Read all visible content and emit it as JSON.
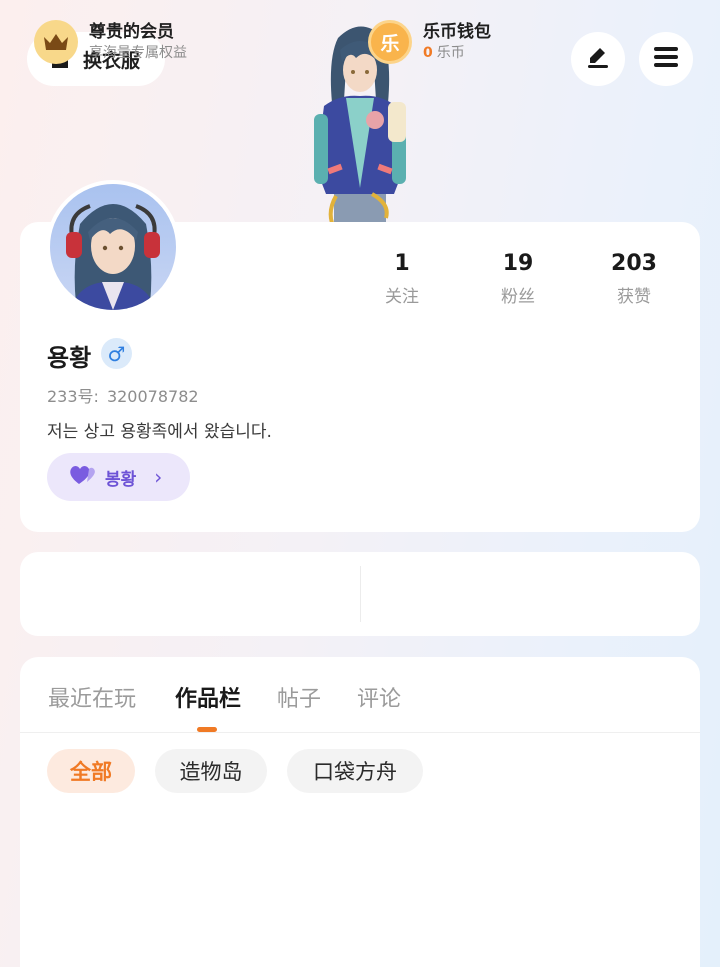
{
  "header": {
    "outfit_label": "换衣服",
    "edit_icon": "edit-pen-icon",
    "menu_icon": "hamburger-menu-icon"
  },
  "stats": [
    {
      "value": "1",
      "label": "关注"
    },
    {
      "value": "19",
      "label": "粉丝"
    },
    {
      "value": "203",
      "label": "获赞"
    }
  ],
  "profile": {
    "name": "용황",
    "gender_symbol": "♂",
    "uid_label": "233号:",
    "uid_value": "320078782",
    "bio": "저는 상고 용황족에서 왔습니다.",
    "tag_label": "봉황",
    "tag_chevron": "›"
  },
  "benefits": {
    "member_title": "尊贵的会员",
    "member_sub": "享海量专属权益",
    "wallet_title": "乐币钱包",
    "wallet_coin_glyph": "乐",
    "wallet_amount": "0",
    "wallet_unit": "乐币"
  },
  "tabs": [
    {
      "label": "最近在玩",
      "active": false
    },
    {
      "label": "作品栏",
      "active": true
    },
    {
      "label": "帖子",
      "active": false
    },
    {
      "label": "评论",
      "active": false
    }
  ],
  "filters": [
    {
      "label": "全部",
      "active": true
    },
    {
      "label": "造物岛",
      "active": false
    },
    {
      "label": "口袋方舟",
      "active": false
    }
  ],
  "colors": {
    "accent": "#f07a25",
    "tag_purple": "#6d53d6",
    "gender_blue": "#2f7fe0"
  }
}
